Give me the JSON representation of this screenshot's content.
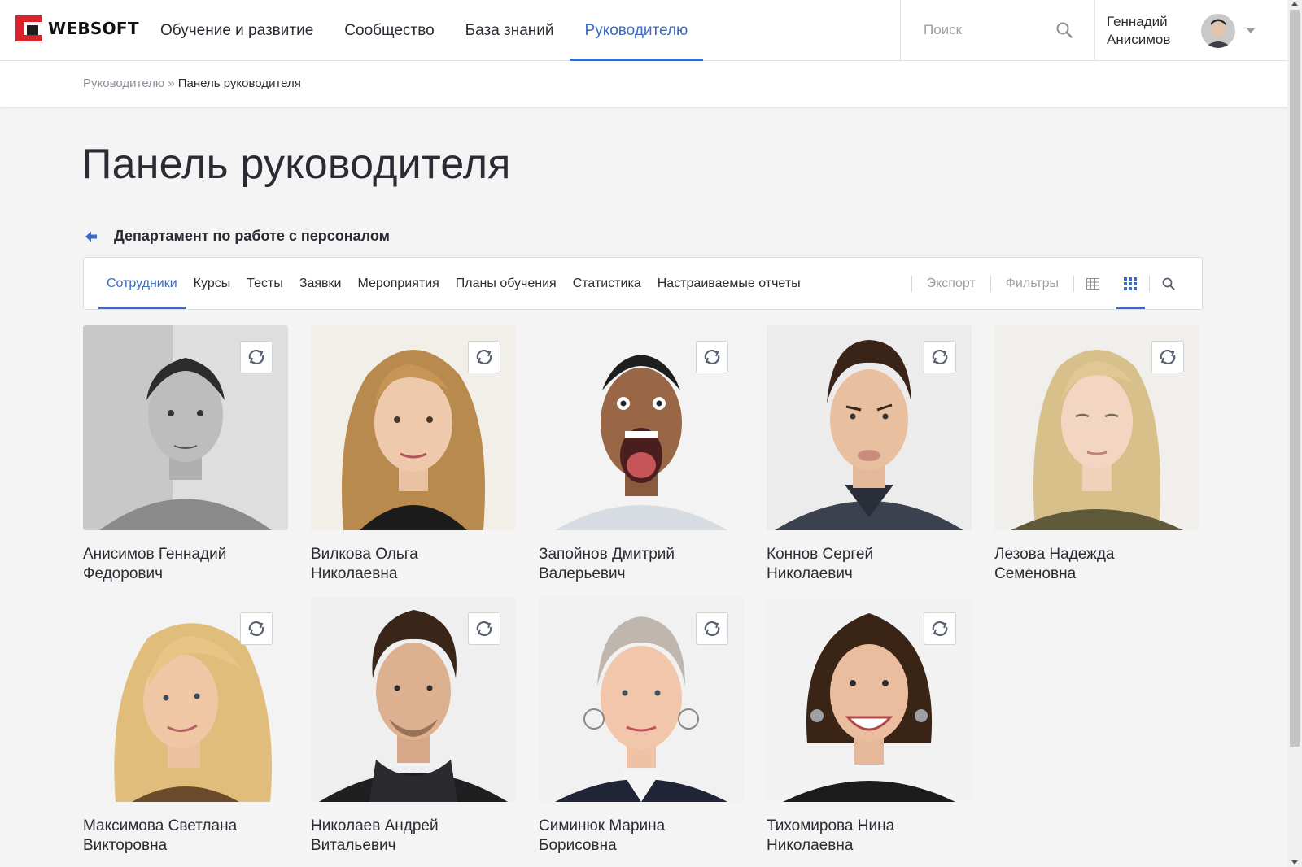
{
  "header": {
    "logo_text": "WEBSOFT",
    "nav": [
      {
        "label": "Обучение и развитие",
        "active": false
      },
      {
        "label": "Сообщество",
        "active": false
      },
      {
        "label": "База знаний",
        "active": false
      },
      {
        "label": "Руководителю",
        "active": true
      }
    ],
    "search": {
      "placeholder": "Поиск"
    },
    "user": {
      "first_name": "Геннадий",
      "last_name": "Анисимов"
    }
  },
  "breadcrumb": {
    "parent": "Руководителю",
    "separator": "»",
    "current": "Панель руководителя"
  },
  "page_title": "Панель руководителя",
  "department": {
    "title": "Департамент по работе с персоналом"
  },
  "tabs": [
    {
      "label": "Сотрудники",
      "active": true
    },
    {
      "label": "Курсы",
      "active": false
    },
    {
      "label": "Тесты",
      "active": false
    },
    {
      "label": "Заявки",
      "active": false
    },
    {
      "label": "Мероприятия",
      "active": false
    },
    {
      "label": "Планы обучения",
      "active": false
    },
    {
      "label": "Статистика",
      "active": false
    },
    {
      "label": "Настраиваемые отчеты",
      "active": false
    }
  ],
  "tools": {
    "export_label": "Экспорт",
    "filters_label": "Фильтры",
    "view_mode": "grid"
  },
  "employees": [
    {
      "surname_name": "Анисимов Геннадий",
      "patronymic": "Федорович"
    },
    {
      "surname_name": "Вилкова Ольга",
      "patronymic": "Николаевна"
    },
    {
      "surname_name": "Запойнов Дмитрий",
      "patronymic": "Валерьевич"
    },
    {
      "surname_name": "Коннов Сергей",
      "patronymic": "Николаевич"
    },
    {
      "surname_name": "Лезова Надежда",
      "patronymic": "Семеновна"
    },
    {
      "surname_name": "Максимова Светлана",
      "patronymic": "Викторовна"
    },
    {
      "surname_name": "Николаев Андрей",
      "patronymic": "Витальевич"
    },
    {
      "surname_name": "Симинюк Марина",
      "patronymic": "Борисовна"
    },
    {
      "surname_name": "Тихомирова Нина",
      "patronymic": "Николаевна"
    }
  ],
  "colors": {
    "accent": "#3a6bc6",
    "brand_red": "#d8232a",
    "background": "#f4f4f4"
  }
}
